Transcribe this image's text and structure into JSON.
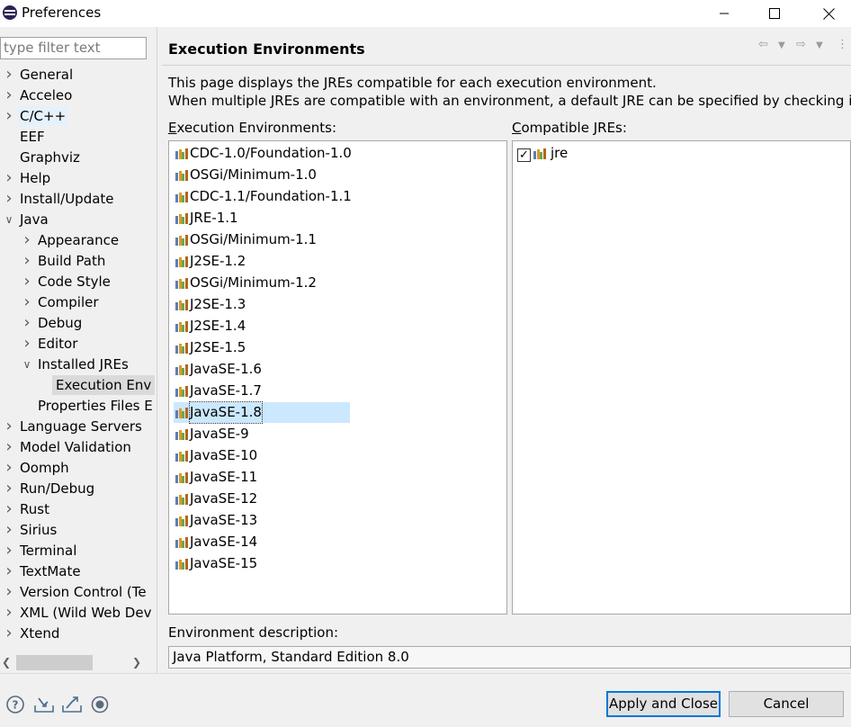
{
  "window": {
    "title": "Preferences"
  },
  "filter": {
    "placeholder": "type filter text"
  },
  "tree": [
    {
      "label": "General",
      "expandable": true
    },
    {
      "label": "Acceleo",
      "expandable": true
    },
    {
      "label": "C/C++",
      "expandable": true
    },
    {
      "label": "EEF",
      "expandable": false
    },
    {
      "label": "Graphviz",
      "expandable": false
    },
    {
      "label": "Help",
      "expandable": true
    },
    {
      "label": "Install/Update",
      "expandable": true
    },
    {
      "label": "Java",
      "expandable": true,
      "expanded": true
    },
    {
      "label": "Appearance",
      "expandable": true
    },
    {
      "label": "Build Path",
      "expandable": true
    },
    {
      "label": "Code Style",
      "expandable": true
    },
    {
      "label": "Compiler",
      "expandable": true
    },
    {
      "label": "Debug",
      "expandable": true
    },
    {
      "label": "Editor",
      "expandable": true
    },
    {
      "label": "Installed JREs",
      "expandable": true,
      "expanded": true
    },
    {
      "label": "Execution Env",
      "expandable": false,
      "selected": true
    },
    {
      "label": "Properties Files E",
      "expandable": false
    },
    {
      "label": "Language Servers",
      "expandable": true
    },
    {
      "label": "Model Validation",
      "expandable": true
    },
    {
      "label": "Oomph",
      "expandable": true
    },
    {
      "label": "Run/Debug",
      "expandable": true
    },
    {
      "label": "Rust",
      "expandable": true
    },
    {
      "label": "Sirius",
      "expandable": true
    },
    {
      "label": "Terminal",
      "expandable": true
    },
    {
      "label": "TextMate",
      "expandable": true
    },
    {
      "label": "Version Control (Te",
      "expandable": true
    },
    {
      "label": "XML (Wild Web Dev",
      "expandable": true
    },
    {
      "label": "Xtend",
      "expandable": true
    }
  ],
  "page": {
    "title": "Execution Environments",
    "description_line1": "This page displays the JREs compatible for each execution environment.",
    "description_line2": "When multiple JREs are compatible with an environment, a default JRE can be specified by checking it.",
    "env_label_mnemonic": "E",
    "env_label_rest": "xecution Environments:",
    "jre_label_mnemonic": "C",
    "jre_label_rest": "ompatible JREs:",
    "environments": [
      "CDC-1.0/Foundation-1.0",
      "OSGi/Minimum-1.0",
      "CDC-1.1/Foundation-1.1",
      "JRE-1.1",
      "OSGi/Minimum-1.1",
      "J2SE-1.2",
      "OSGi/Minimum-1.2",
      "J2SE-1.3",
      "J2SE-1.4",
      "J2SE-1.5",
      "JavaSE-1.6",
      "JavaSE-1.7",
      "JavaSE-1.8",
      "JavaSE-9",
      "JavaSE-10",
      "JavaSE-11",
      "JavaSE-12",
      "JavaSE-13",
      "JavaSE-14",
      "JavaSE-15"
    ],
    "selected_environment": "JavaSE-1.8",
    "compatible_jres": [
      {
        "name": "jre",
        "checked": true
      }
    ],
    "env_desc_label": "Environment description:",
    "env_desc_value": "Java Platform, Standard Edition 8.0"
  },
  "buttons": {
    "apply_close": "Apply and Close",
    "cancel": "Cancel"
  },
  "icons": {
    "help": "help-icon",
    "import": "import-icon",
    "export": "export-icon",
    "record": "oomph-record-icon",
    "nav_back": "back-arrow-icon",
    "nav_forward": "forward-arrow-icon",
    "view_menu": "view-menu-icon"
  }
}
